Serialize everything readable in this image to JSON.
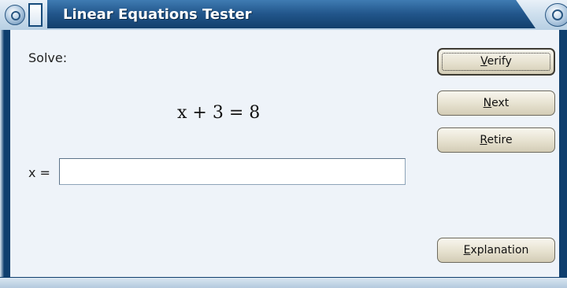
{
  "window": {
    "title": "Linear Equations Tester"
  },
  "main": {
    "prompt_label": "Solve:",
    "equation": "x + 3 = 8",
    "answer_label": "x =",
    "answer_value": "",
    "answer_placeholder": ""
  },
  "buttons": {
    "verify": {
      "mnemonic": "V",
      "rest": "erify"
    },
    "next": {
      "mnemonic": "N",
      "rest": "ext"
    },
    "retire": {
      "mnemonic": "R",
      "rest": "etire"
    },
    "explanation": {
      "mnemonic": "E",
      "rest": "xplanation"
    }
  },
  "icons": {
    "window_menu": "window-menu-icon",
    "sticky": "sticky-icon",
    "maximize": "maximize-icon"
  }
}
